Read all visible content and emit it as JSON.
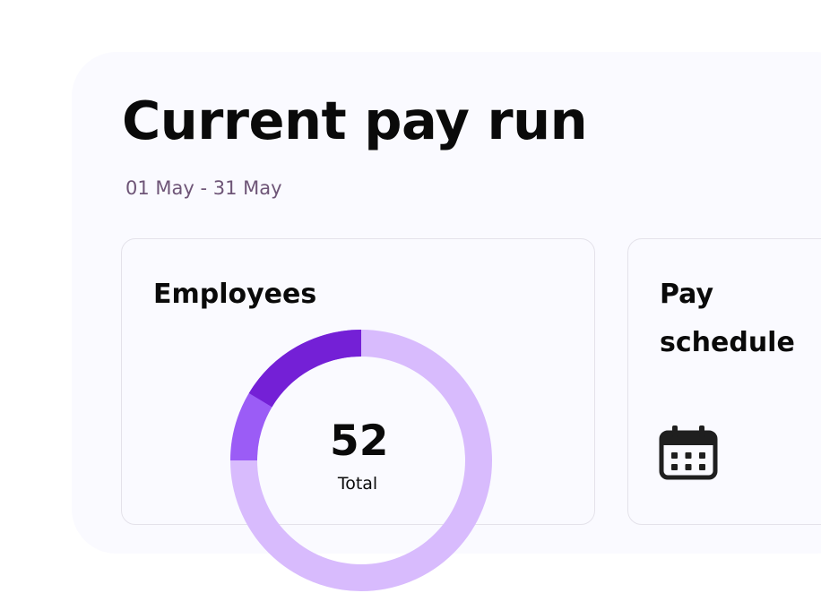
{
  "header": {
    "title": "Current pay run",
    "date_range": "01 May - 31 May"
  },
  "employees_card": {
    "title": "Employees",
    "total": "52",
    "total_label": "Total"
  },
  "pay_schedule_card": {
    "title": "Pay schedule",
    "icon": "calendar-icon"
  },
  "colors": {
    "segment_dark": "#7420d6",
    "segment_medium": "#9b5cf6",
    "segment_light": "#d8bbfd",
    "panel_bg": "#fafaff",
    "subtitle": "#6e5577"
  }
}
